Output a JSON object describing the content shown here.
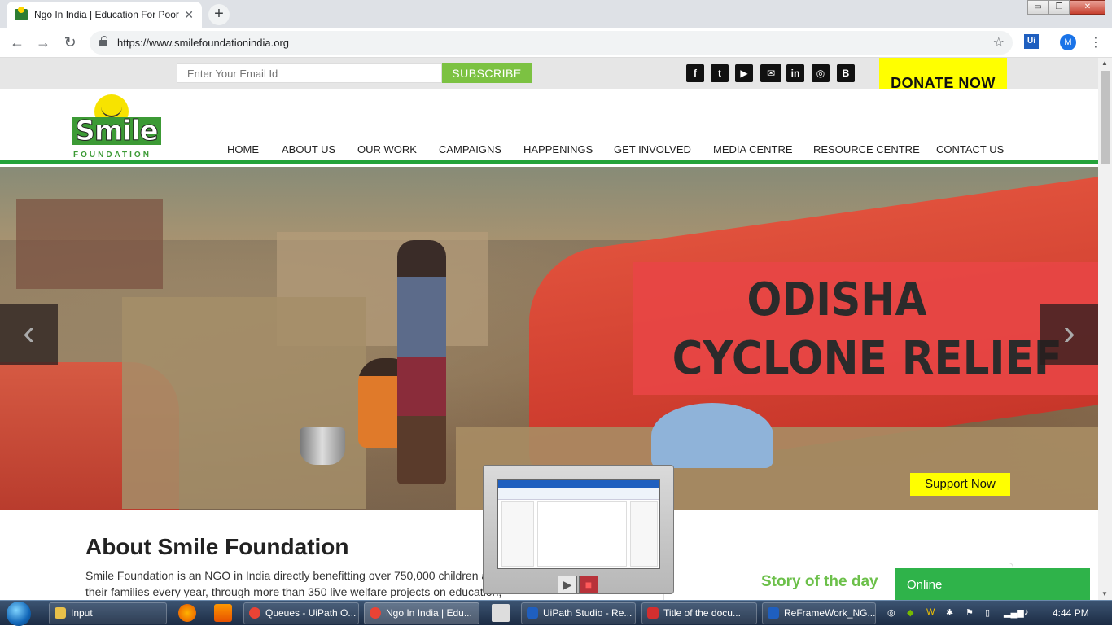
{
  "browser": {
    "tab_title": "Ngo In India | Education For Poor",
    "tab_close": "✕",
    "new_tab": "+",
    "url": "https://www.smilefoundationindia.org",
    "profile_initial": "M",
    "ext_label": "Ui",
    "win_min": "▭",
    "win_max": "❐",
    "win_close": "✕"
  },
  "topbar": {
    "email_placeholder": "Enter Your Email Id",
    "subscribe": "SUBSCRIBE",
    "donate": "DONATE NOW",
    "social": [
      {
        "icon": "facebook-icon",
        "glyph": "f"
      },
      {
        "icon": "twitter-icon",
        "glyph": "t"
      },
      {
        "icon": "youtube-icon",
        "glyph": "▶"
      },
      {
        "icon": "email-icon",
        "glyph": "✉"
      },
      {
        "icon": "linkedin-icon",
        "glyph": "in"
      },
      {
        "icon": "instagram-icon",
        "glyph": "◎"
      },
      {
        "icon": "blogger-icon",
        "glyph": "B"
      }
    ]
  },
  "logo": {
    "word": "Smile",
    "subtitle": "FOUNDATION"
  },
  "nav": [
    "HOME",
    "ABOUT US",
    "OUR WORK",
    "CAMPAIGNS",
    "HAPPENINGS",
    "GET INVOLVED",
    "MEDIA CENTRE",
    "RESOURCE CENTRE",
    "CONTACT US"
  ],
  "hero": {
    "line1": "ODISHA",
    "line2": "CYCLONE RELIEF",
    "support": "Support Now",
    "prev": "‹",
    "next": "›"
  },
  "about": {
    "title": "About Smile Foundation",
    "text": "Smile Foundation is an NGO in India directly benefitting over 750,000 children and their families every year, through more than 350 live welfare projects on education,"
  },
  "story": "Story of the day",
  "chat": "Online",
  "taskbar": {
    "items": [
      {
        "label": "Input",
        "color": "#e8c04a"
      },
      {
        "label": "Queues - UiPath O...",
        "color": "#ea4335"
      },
      {
        "label": "Ngo In India | Edu...",
        "color": "#ea4335"
      },
      {
        "label": "UiPath Studio - Re...",
        "color": "#1f5fbf"
      },
      {
        "label": "Title of the docu...",
        "color": "#d32f2f"
      },
      {
        "label": "ReFrameWork_NG...",
        "color": "#1f5fbf"
      }
    ],
    "time": "4:44 PM"
  },
  "colors": {
    "green": "#24a33a",
    "yellow": "#ffff00",
    "banner_red": "#e84646",
    "subscribe_green": "#7cc242"
  }
}
